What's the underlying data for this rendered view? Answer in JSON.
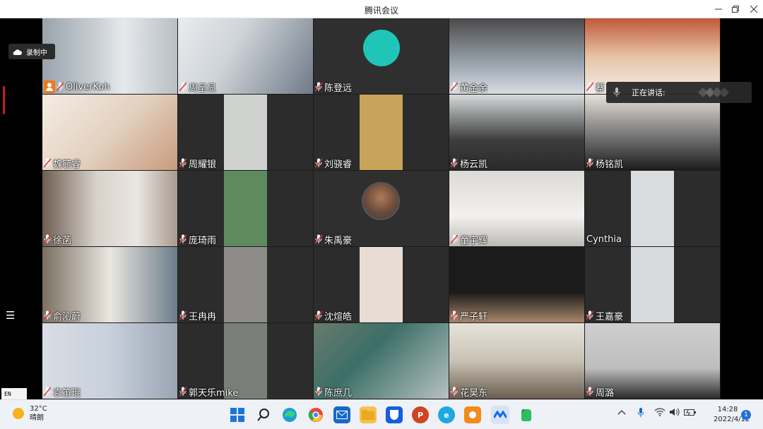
{
  "window": {
    "title": "腾讯会议"
  },
  "recording": {
    "label": "录制中"
  },
  "speaking": {
    "label": "正在讲话:"
  },
  "participants": [
    {
      "name": "OliverKoh",
      "host": true
    },
    {
      "name": "周呈显"
    },
    {
      "name": "陈登远"
    },
    {
      "name": "黄金余"
    },
    {
      "name": "蔡"
    },
    {
      "name": "魏毓睿"
    },
    {
      "name": "周耀银"
    },
    {
      "name": "刘骁睿"
    },
    {
      "name": "杨云凯"
    },
    {
      "name": "杨铭凯"
    },
    {
      "name": "徐菡"
    },
    {
      "name": "庞琦雨"
    },
    {
      "name": "朱禹豪"
    },
    {
      "name": "童宇辉"
    },
    {
      "name": "Cynthia",
      "no_mic": true
    },
    {
      "name": "俞沁蔚"
    },
    {
      "name": "王冉冉"
    },
    {
      "name": "沈煊皓"
    },
    {
      "name": "严子轩"
    },
    {
      "name": "王嘉豪"
    },
    {
      "name": "袁笛琨"
    },
    {
      "name": "郭天乐mike"
    },
    {
      "name": "陈庶几"
    },
    {
      "name": "花昊东"
    },
    {
      "name": "周潞"
    }
  ],
  "input_indicator": "EN",
  "weather": {
    "temp": "32°C",
    "desc": "晴朗"
  },
  "clock": {
    "time": "14:28",
    "date": "2022/4/12"
  },
  "notifications": "1",
  "taskbar": {
    "apps": [
      "start-icon",
      "search-icon",
      "edge-icon",
      "chrome-icon",
      "mail-icon",
      "files-icon",
      "bitwarden-icon",
      "powerpoint-icon",
      "ie-icon",
      "orange-app-icon",
      "tencent-meeting-icon",
      "evernote-icon"
    ]
  }
}
